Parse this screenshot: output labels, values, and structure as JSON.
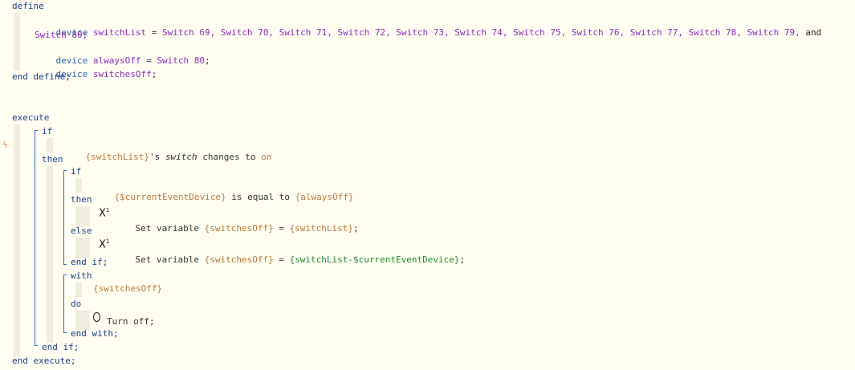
{
  "define": {
    "open": "define",
    "line1_kw": "device",
    "line1_name": "switchList",
    "line1_eq": " = ",
    "line1_list": "Switch 69, Switch 70, Switch 71, Switch 72, Switch 73, Switch 74, Switch 75, Switch 76, Switch 77, Switch 78, Switch 79,",
    "line1_and": " and",
    "line2": "Switch 80;",
    "line3_kw": "device",
    "line3_name": "alwaysOff",
    "line3_eq": " = ",
    "line3_val": "Switch 80",
    "line3_end": ";",
    "line4_kw": "device",
    "line4_name": "switchesOff",
    "line4_end": ";",
    "close": "end define;"
  },
  "execute": {
    "open": "execute",
    "if1": "if",
    "trigger_var": "{switchList}",
    "trigger_mid": "'s ",
    "trigger_attr": "switch",
    "trigger_txt": " changes to ",
    "trigger_val": "on",
    "then1": "then",
    "if2": "if",
    "cond_var": "{$currentEventDevice}",
    "cond_txt": " is equal to ",
    "cond_val": "{alwaysOff}",
    "then2": "then",
    "act1_txt": "Set variable ",
    "act1_var": "{switchesOff}",
    "act1_eq": " = ",
    "act1_val": "{switchList}",
    "act1_end": ";",
    "else": "else",
    "act2_txt": "Set variable ",
    "act2_var": "{switchesOff}",
    "act2_eq": " = ",
    "act2_val": "{switchList-$currentEventDevice}",
    "act2_end": ";",
    "endif2": "end if;",
    "with": "with",
    "with_var": "{switchesOff}",
    "do": "do",
    "turnoff": "Turn off;",
    "endwith": "end with;",
    "endif1": "end if;",
    "close": "end execute;"
  },
  "icons": {
    "set_variable": "X¹",
    "trigger": "bolt-icon",
    "turn_off": "circle-icon"
  },
  "colors": {
    "background": "#fffef1",
    "keyword": "#1a3d8f",
    "device_name": "#8a2bbf",
    "variable": "#c0783c",
    "expression": "#1f8a2b",
    "block_bar": "#2a6cc4"
  }
}
